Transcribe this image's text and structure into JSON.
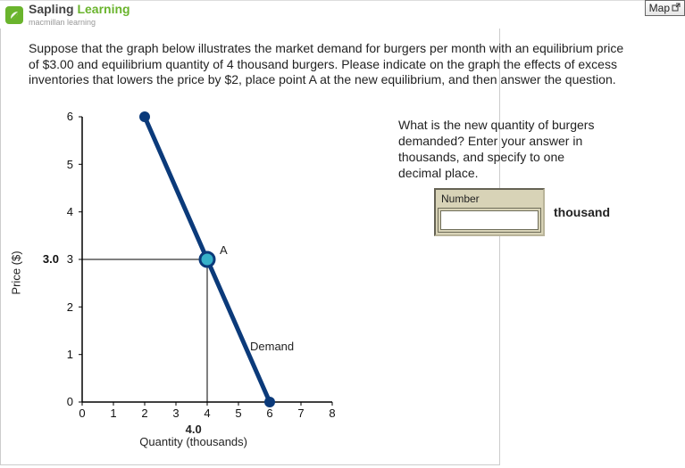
{
  "brand": {
    "word1": "Sapling",
    "word2": "Learning",
    "sub": "macmillan learning"
  },
  "map_button": "Map",
  "prompt": "Suppose that the graph below illustrates the market demand for burgers per month with an equilibrium price of $3.00 and equilibrium quantity of 4 thousand burgers. Please indicate on the graph the effects of excess inventories that lowers the price by $2, place point A at the new equilibrium, and then answer the question.",
  "question": "What is the new quantity of burgers demanded? Enter your answer in thousands, and specify to one decimal place.",
  "number_label": "Number",
  "answer_value": "",
  "unit": "thousand",
  "chart_data": {
    "type": "line",
    "title": "",
    "xlabel": "Quantity (thousands)",
    "ylabel": "Price ($)",
    "xlim": [
      0,
      8
    ],
    "ylim": [
      0,
      6
    ],
    "x_ticks": [
      0,
      1,
      2,
      3,
      4,
      5,
      6,
      7,
      8
    ],
    "y_ticks": [
      0,
      1,
      2,
      3,
      4,
      5,
      6
    ],
    "y_extra_tick": {
      "value": 3,
      "label": "3.0"
    },
    "x_extra_tick": {
      "value": 4,
      "label": "4.0"
    },
    "series": [
      {
        "name": "Demand",
        "x": [
          2,
          6
        ],
        "y": [
          6,
          0
        ],
        "color": "#0b3a7a"
      }
    ],
    "guide_lines": [
      {
        "from": {
          "x": 0,
          "y": 3
        },
        "to": {
          "x": 4,
          "y": 3
        }
      },
      {
        "from": {
          "x": 4,
          "y": 0
        },
        "to": {
          "x": 4,
          "y": 3
        }
      }
    ],
    "points": [
      {
        "name": "A",
        "x": 4,
        "y": 3,
        "label": "A",
        "color": "#0b82a0"
      },
      {
        "name": "demand-start",
        "x": 2,
        "y": 6,
        "color": "#0b3a7a"
      },
      {
        "name": "demand-end",
        "x": 6,
        "y": 0,
        "color": "#0b3a7a"
      }
    ],
    "annotations": [
      {
        "text": "Demand",
        "x": 5.5,
        "y": 1.1
      }
    ]
  }
}
